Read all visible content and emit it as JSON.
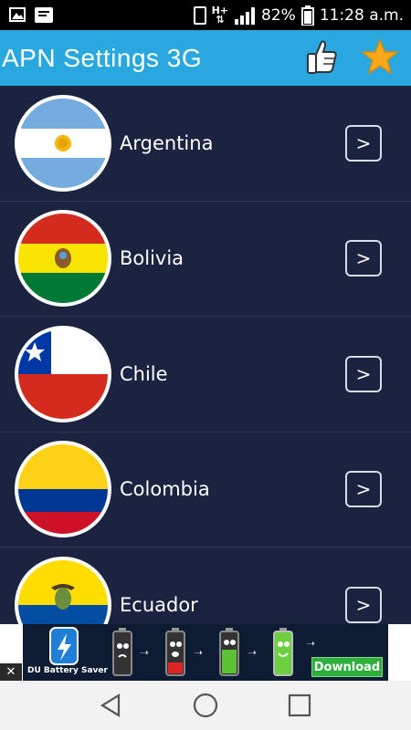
{
  "status_bar": {
    "battery_percent": "82%",
    "time": "11:28 a.m.",
    "network_label": "H+"
  },
  "app_bar": {
    "title": "APN Settings 3G",
    "like_icon": "thumbs-up-icon",
    "favorite_icon": "star-icon"
  },
  "countries": [
    {
      "name": "Argentina",
      "flag": "argentina-flag-icon"
    },
    {
      "name": "Bolivia",
      "flag": "bolivia-flag-icon"
    },
    {
      "name": "Chile",
      "flag": "chile-flag-icon"
    },
    {
      "name": "Colombia",
      "flag": "colombia-flag-icon"
    },
    {
      "name": "Ecuador",
      "flag": "ecuador-flag-icon"
    }
  ],
  "row_action_glyph": ">",
  "ad": {
    "brand": "DU Battery Saver",
    "cta": "Download",
    "close": "✕"
  },
  "colors": {
    "app_bar": "#29a8e0",
    "list_background": "#1c2340",
    "ad_cta": "#2eae3a"
  }
}
